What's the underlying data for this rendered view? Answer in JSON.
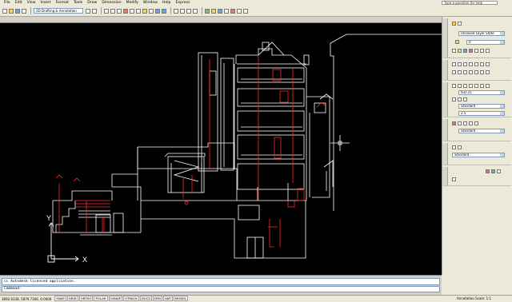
{
  "menu": {
    "items": [
      "File",
      "Edit",
      "View",
      "Insert",
      "Format",
      "Tools",
      "Draw",
      "Dimension",
      "Modify",
      "Window",
      "Help",
      "Express"
    ]
  },
  "search": {
    "placeholder": "Type a question for help"
  },
  "toolbar": {
    "workspace": "2D Drafting & Annotation"
  },
  "palette": {
    "layer_state": "Unsaved Layer State",
    "layer_current": "0",
    "dim_style": "ISO-25",
    "text_style": "Standard",
    "text_height": "2.5",
    "mleader_style": "Standard",
    "table_style": "Standard"
  },
  "command": {
    "history": "cc Autodesk licensed application.",
    "prompt": "Command:"
  },
  "status": {
    "coords": "3692.6338, 5879.7166, 0.0000",
    "toggles": [
      "SNAP",
      "GRID",
      "ORTHO",
      "POLAR",
      "OSNAP",
      "OTRACK",
      "DUCS",
      "DYN",
      "LWT",
      "MODEL"
    ],
    "annotation_scale": "Annotation Scale:",
    "scale_value": "1:1"
  },
  "ucs": {
    "x_label": "X",
    "y_label": "Y"
  },
  "colors": {
    "canvas": "#000000",
    "lines_white": "#ffffff",
    "lines_red": "#ff2a2a"
  }
}
